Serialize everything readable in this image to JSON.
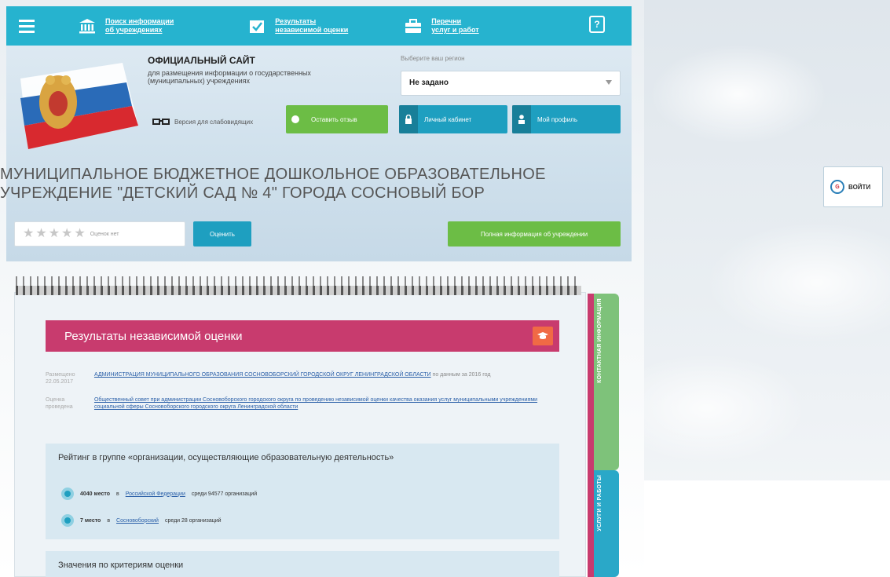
{
  "topnav": {
    "items": [
      {
        "label": "Поиск информации\nоб учреждениях"
      },
      {
        "label": "Результаты\nнезависимой оценки"
      },
      {
        "label": "Перечни\nуслуг и работ"
      }
    ],
    "help": "?"
  },
  "header": {
    "site_title": "ОФИЦИАЛЬНЫЙ САЙТ",
    "site_subtitle": "для размещения информации о государственных (муниципальных) учреждениях",
    "accessibility_label": "Версия для слабовидящих",
    "region_label": "Выберите ваш регион",
    "region_value": "Не задано",
    "buttons": {
      "feedback": "Оставить отзыв",
      "cabinet": "Личный кабинет",
      "profile": "Мой профиль"
    }
  },
  "org": {
    "title": "МУНИЦИПАЛЬНОЕ БЮДЖЕТНОЕ ДОШКОЛЬНОЕ ОБРАЗОВАТЕЛЬНОЕ УЧРЕЖДЕНИЕ \"ДЕТСКИЙ САД № 4\" ГОРОДА СОСНОВЫЙ БОР",
    "rating_text": "Оценок нет",
    "rate_button": "Оценить",
    "full_info_button": "Полная информация об учреждении"
  },
  "results": {
    "heading": "Результаты независимой оценки",
    "meta1_label": "Размещено 22.05.2017",
    "meta1_link": "АДМИНИСТРАЦИЯ МУНИЦИПАЛЬНОГО ОБРАЗОВАНИЯ СОСНОВОБОРСКИЙ ГОРОДСКОЙ ОКРУГ ЛЕНИНГРАДСКОЙ ОБЛАСТИ",
    "meta1_tail": "по данным за 2016 год",
    "meta2_label": "Оценка проведена",
    "meta2_link": "Общественный совет при администрации Сосновоборского городского округа по проведению независимой оценки качества оказания услуг муниципальными учреждениями социальной сферы Сосновоборского городского округа Ленинградской области",
    "rating_title": "Рейтинг в группе «организации, осуществляющие образовательную деятельность»",
    "row1_place": "4040 место",
    "row1_in": "в",
    "row1_link": "Российской Федерации",
    "row1_tail": "среди 94577 организаций",
    "row2_place": "7 место",
    "row2_in": "в",
    "row2_link": "Сосновоборский",
    "row2_tail": "среди 28 организаций",
    "criteria_title": "Значения по критериям оценки"
  },
  "side_tabs": {
    "green": "КОНТАКТНАЯ ИНФОРМАЦИЯ",
    "blue": "УСЛУГИ И РАБОТЫ"
  },
  "login": {
    "label": "ВОЙТИ"
  },
  "colors": {
    "nav": "#26b3cf",
    "green": "#6cbd45",
    "blue": "#1e9fc0",
    "magenta": "#c83b6e"
  }
}
